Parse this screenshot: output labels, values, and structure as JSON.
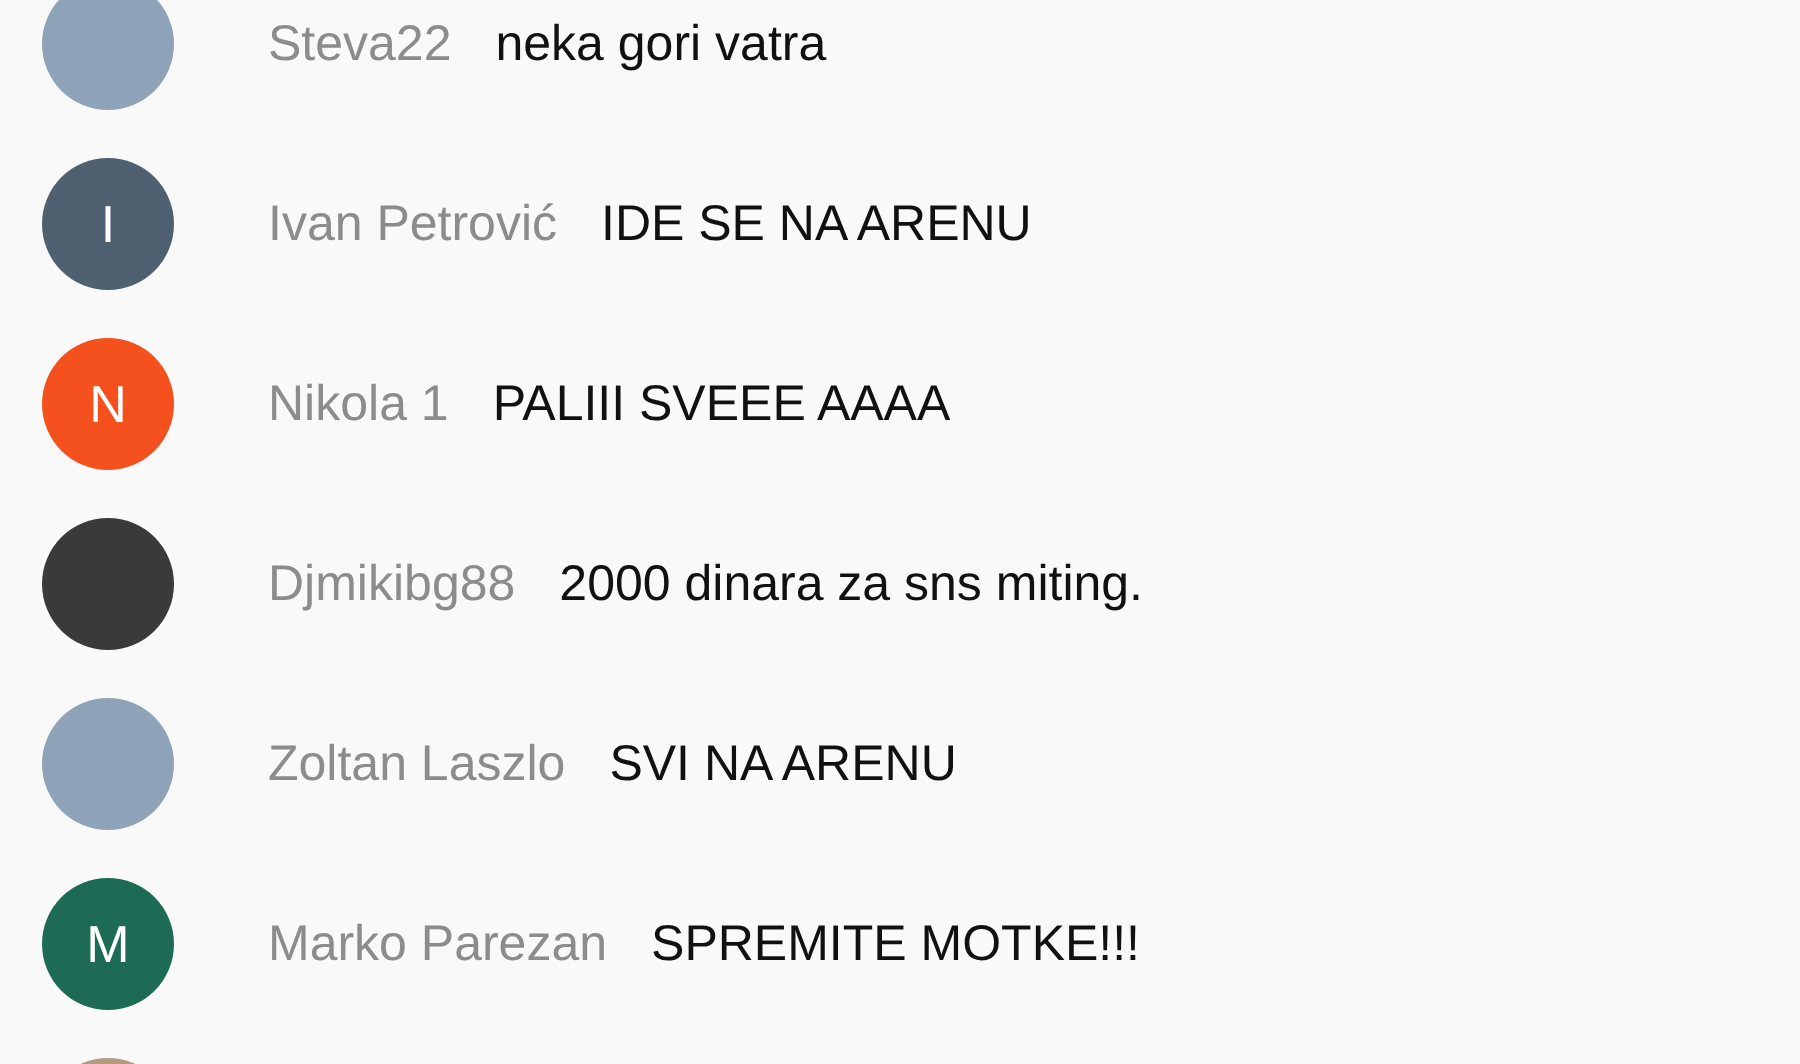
{
  "chat": [
    {
      "kind": "photo",
      "author": "Steva22",
      "message": "neka gori vatra"
    },
    {
      "kind": "letter",
      "letter": "I",
      "color": "#4f6070",
      "author": "Ivan Petrović",
      "message": "IDE SE NA ARENU"
    },
    {
      "kind": "letter",
      "letter": "N",
      "color": "#f4511e",
      "author": "Nikola 1",
      "message": "PALIII SVEEE AAAA"
    },
    {
      "kind": "photo",
      "author": "Djmikibg88",
      "message": "2000 dinara za sns miting."
    },
    {
      "kind": "photo",
      "author": "Zoltan Laszlo",
      "message": "SVI NA ARENU"
    },
    {
      "kind": "letter",
      "letter": "M",
      "color": "#1d6b55",
      "author": "Marko Parezan",
      "message": "SPREMITE MOTKE!!!"
    },
    {
      "kind": "photo"
    }
  ]
}
